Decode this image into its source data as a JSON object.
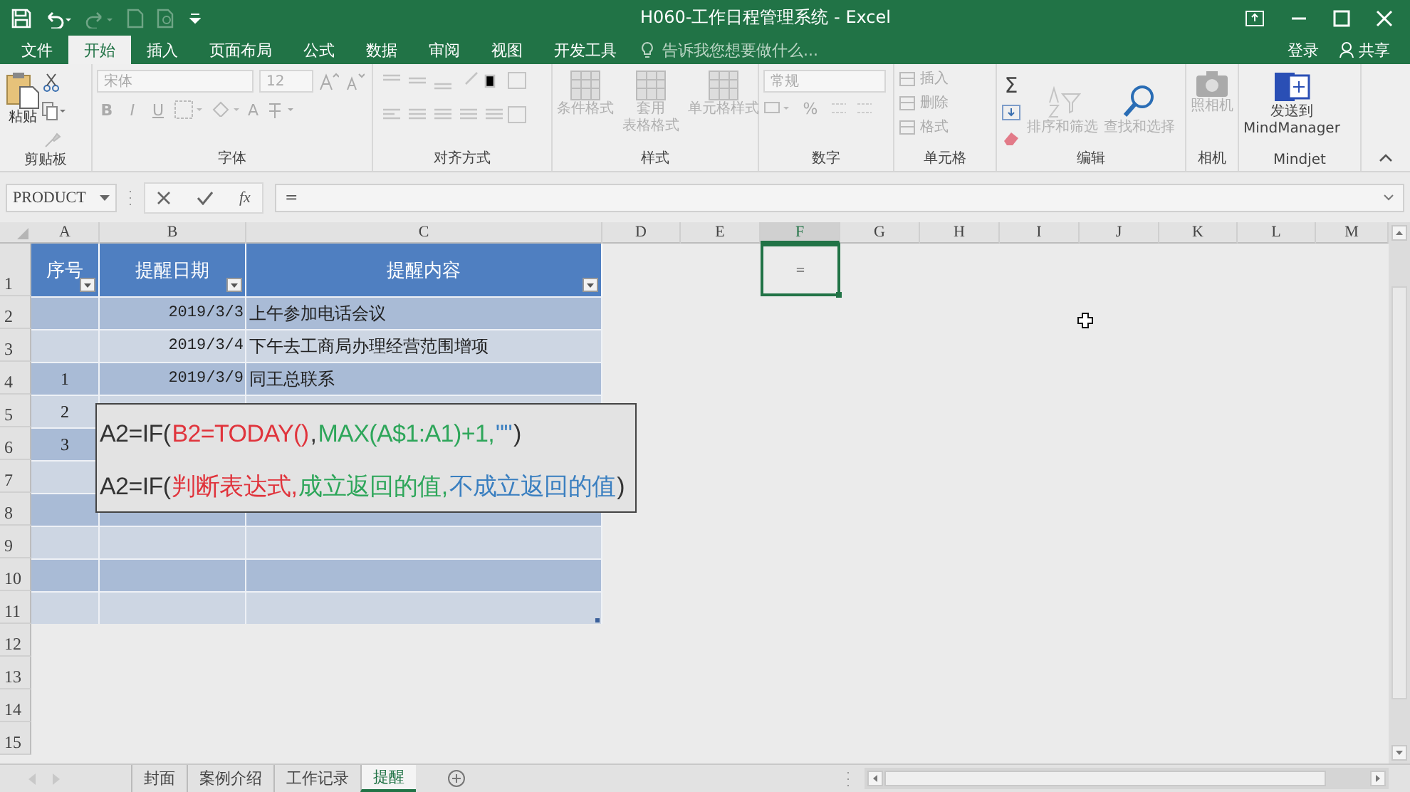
{
  "title_bar": {
    "title": "H060-工作日程管理系统 - Excel"
  },
  "ribbon_tabs": [
    {
      "label": "文件",
      "selected": false
    },
    {
      "label": "开始",
      "selected": true
    },
    {
      "label": "插入",
      "selected": false
    },
    {
      "label": "页面布局",
      "selected": false
    },
    {
      "label": "公式",
      "selected": false
    },
    {
      "label": "数据",
      "selected": false
    },
    {
      "label": "审阅",
      "selected": false
    },
    {
      "label": "视图",
      "selected": false
    },
    {
      "label": "开发工具",
      "selected": false
    }
  ],
  "tell_me": {
    "placeholder": "告诉我您想要做什么..."
  },
  "account": {
    "sign_in": "登录",
    "share": "共享"
  },
  "ribbon": {
    "clipboard": {
      "paste": "粘贴",
      "label": "剪贴板"
    },
    "font": {
      "name": "宋体",
      "size": "12",
      "format_buttons": [
        "B",
        "I",
        "U"
      ],
      "font_color": "A",
      "label": "字体"
    },
    "alignment": {
      "label": "对齐方式"
    },
    "styles": {
      "buttons": [
        {
          "lines": [
            "条件格式"
          ]
        },
        {
          "lines": [
            "套用",
            "表格格式"
          ]
        },
        {
          "lines": [
            "单元格样式"
          ]
        }
      ],
      "label": "样式"
    },
    "number": {
      "format": "常规",
      "percent": "%",
      "label": "数字"
    },
    "cells": {
      "buttons": [
        "插入",
        "删除",
        "格式"
      ],
      "label": "单元格"
    },
    "editing": {
      "sum": "Σ",
      "buttons": [
        {
          "label": "排序和筛选",
          "disabled": true
        },
        {
          "label": "查找和选择",
          "disabled": false
        }
      ],
      "label": "编辑"
    },
    "camera": {
      "button": "照相机",
      "label": "相机"
    },
    "mindjet": {
      "button_lines": [
        "发送到",
        "MindManager"
      ],
      "label": "Mindjet"
    }
  },
  "formula_bar": {
    "name_box": "PRODUCT",
    "function_symbol": "fx",
    "content": "="
  },
  "grid": {
    "columns": [
      {
        "label": "A",
        "selected": false
      },
      {
        "label": "B",
        "selected": false
      },
      {
        "label": "C",
        "selected": false
      },
      {
        "label": "D",
        "selected": false
      },
      {
        "label": "E",
        "selected": false
      },
      {
        "label": "F",
        "selected": true
      },
      {
        "label": "G",
        "selected": false
      },
      {
        "label": "H",
        "selected": false
      },
      {
        "label": "I",
        "selected": false
      },
      {
        "label": "J",
        "selected": false
      },
      {
        "label": "K",
        "selected": false
      },
      {
        "label": "L",
        "selected": false
      },
      {
        "label": "M",
        "selected": false
      }
    ],
    "row_numbers": [
      "1",
      "2",
      "3",
      "4",
      "5",
      "6",
      "7",
      "8",
      "9",
      "10",
      "11",
      "12",
      "13",
      "14",
      "15"
    ],
    "table_header": [
      {
        "label": "序号"
      },
      {
        "label": "提醒日期"
      },
      {
        "label": "提醒内容"
      }
    ],
    "table_rows": [
      {
        "shaded": true,
        "date": "2019/3/3",
        "content": "上午参加电话会议"
      },
      {
        "shaded": false,
        "date": "2019/3/4",
        "content": "下午去工商局办理经营范围增项"
      },
      {
        "shaded": true,
        "seq": "1",
        "date": "2019/3/9",
        "content": "同王总联系"
      },
      {
        "shaded": false,
        "seq": "2"
      },
      {
        "shaded": true,
        "seq": "3"
      },
      {
        "shaded": false
      },
      {
        "shaded": true
      },
      {
        "shaded": false
      },
      {
        "shaded": true
      },
      {
        "shaded": false
      }
    ],
    "active_cell": {
      "value": "="
    }
  },
  "formula_hint": {
    "lines": [
      {
        "segments": [
          {
            "text": "A2=IF(",
            "color": "#333333"
          },
          {
            "text": "B2=TODAY()",
            "color": "#e0343c"
          },
          {
            "text": ",",
            "color": "#333333"
          },
          {
            "text": "MAX(A$1:A1)+1,",
            "color": "#2ea65a"
          },
          {
            "text": "\"\"",
            "color": "#3a7fc0"
          },
          {
            "text": ")",
            "color": "#333333"
          }
        ]
      },
      {
        "segments": [
          {
            "text": "A2=IF(",
            "color": "#333333"
          },
          {
            "text": "判断表达式,",
            "color": "#e0343c"
          },
          {
            "text": "成立返回的值,",
            "color": "#2ea65a"
          },
          {
            "text": "不成立返回的值",
            "color": "#3a7fc0"
          },
          {
            "text": ")",
            "color": "#333333"
          }
        ]
      }
    ]
  },
  "sheet_tabs": [
    {
      "label": "封面",
      "selected": false
    },
    {
      "label": "案例介绍",
      "selected": false
    },
    {
      "label": "工作记录",
      "selected": false
    },
    {
      "label": "提醒",
      "selected": true
    }
  ]
}
